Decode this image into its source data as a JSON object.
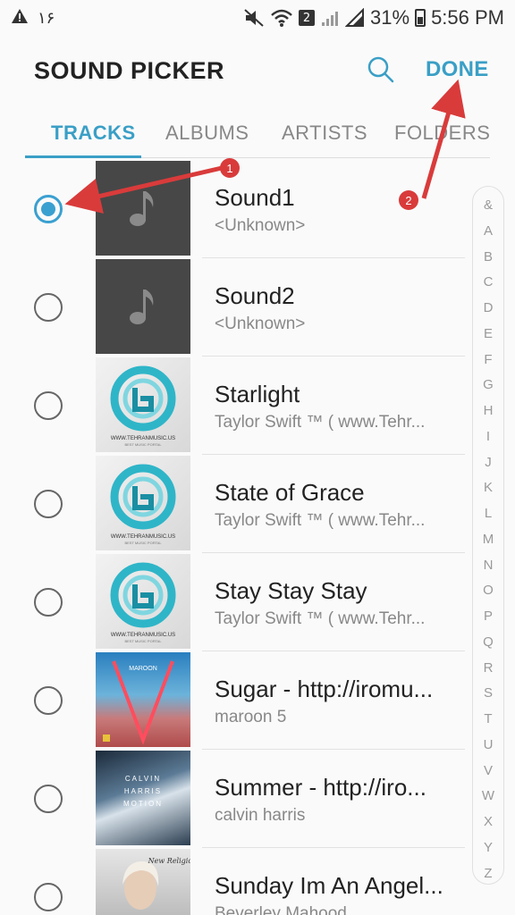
{
  "status_bar": {
    "left_number": "۱۶",
    "sim_badge": "2",
    "battery": "31%",
    "time": "5:56 PM"
  },
  "header": {
    "title": "SOUND PICKER",
    "done_label": "DONE"
  },
  "tabs": [
    {
      "label": "TRACKS",
      "active": true
    },
    {
      "label": "ALBUMS",
      "active": false
    },
    {
      "label": "ARTISTS",
      "active": false
    },
    {
      "label": "FOLDERS",
      "active": false
    }
  ],
  "tracks": [
    {
      "title": "Sound1",
      "subtitle": "<Unknown>",
      "selected": true,
      "art": "music-note"
    },
    {
      "title": "Sound2",
      "subtitle": "<Unknown>",
      "selected": false,
      "art": "music-note"
    },
    {
      "title": "Starlight",
      "subtitle": "Taylor Swift  ™ ( www.Tehr...",
      "selected": false,
      "art": "tehranmusic-logo"
    },
    {
      "title": "State of Grace",
      "subtitle": "Taylor Swift  ™ ( www.Tehr...",
      "selected": false,
      "art": "tehranmusic-logo"
    },
    {
      "title": "Stay Stay Stay",
      "subtitle": "Taylor Swift  ™ ( www.Tehr...",
      "selected": false,
      "art": "tehranmusic-logo"
    },
    {
      "title": "Sugar - http://iromu...",
      "subtitle": "maroon 5",
      "selected": false,
      "art": "maroon5-v-cover"
    },
    {
      "title": "Summer - http://iro...",
      "subtitle": "calvin harris",
      "selected": false,
      "art": "calvin-harris-motion-cover"
    },
    {
      "title": "Sunday Im An Angel...",
      "subtitle": "Beverley Mahood",
      "selected": false,
      "art": "new-religion-cover"
    }
  ],
  "thumb_texts": {
    "tehranmusic": "WWW.TEHRANMUSIC.US",
    "tehranmusic_sub": "BEST MUSIC PORTAL",
    "maroon": "MAROON",
    "calvin": "CALVIN",
    "harris": "HARRIS",
    "motion": "MOTION",
    "new_religion": "New Religion"
  },
  "index_letters": [
    "&",
    "A",
    "B",
    "C",
    "D",
    "E",
    "F",
    "G",
    "H",
    "I",
    "J",
    "K",
    "L",
    "M",
    "N",
    "O",
    "P",
    "Q",
    "R",
    "S",
    "T",
    "U",
    "V",
    "W",
    "X",
    "Y",
    "Z"
  ],
  "annotations": {
    "marker_1": "1",
    "marker_2": "2"
  },
  "colors": {
    "accent": "#3a9fc6",
    "annotation": "#d93b3b",
    "placeholder_bg": "#474747"
  }
}
